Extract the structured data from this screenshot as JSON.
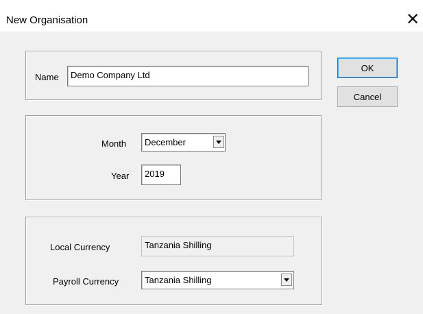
{
  "window": {
    "title": "New Organisation",
    "close_glyph": "✕",
    "close_icon": "close-icon"
  },
  "name_group": {
    "label": "Name",
    "value": "Demo Company Ltd"
  },
  "period_group": {
    "month_label": "Month",
    "month_value": "December",
    "year_label": "Year",
    "year_value": "2019"
  },
  "currency_group": {
    "local_label": "Local Currency",
    "local_value": "Tanzania Shilling",
    "payroll_label": "Payroll Currency",
    "payroll_value": "Tanzania Shilling"
  },
  "buttons": {
    "ok": "OK",
    "cancel": "Cancel"
  },
  "icons": {
    "dropdown": "chevron-down-icon"
  },
  "colors": {
    "accent": "#0078d7",
    "background": "#f0f0f0"
  }
}
